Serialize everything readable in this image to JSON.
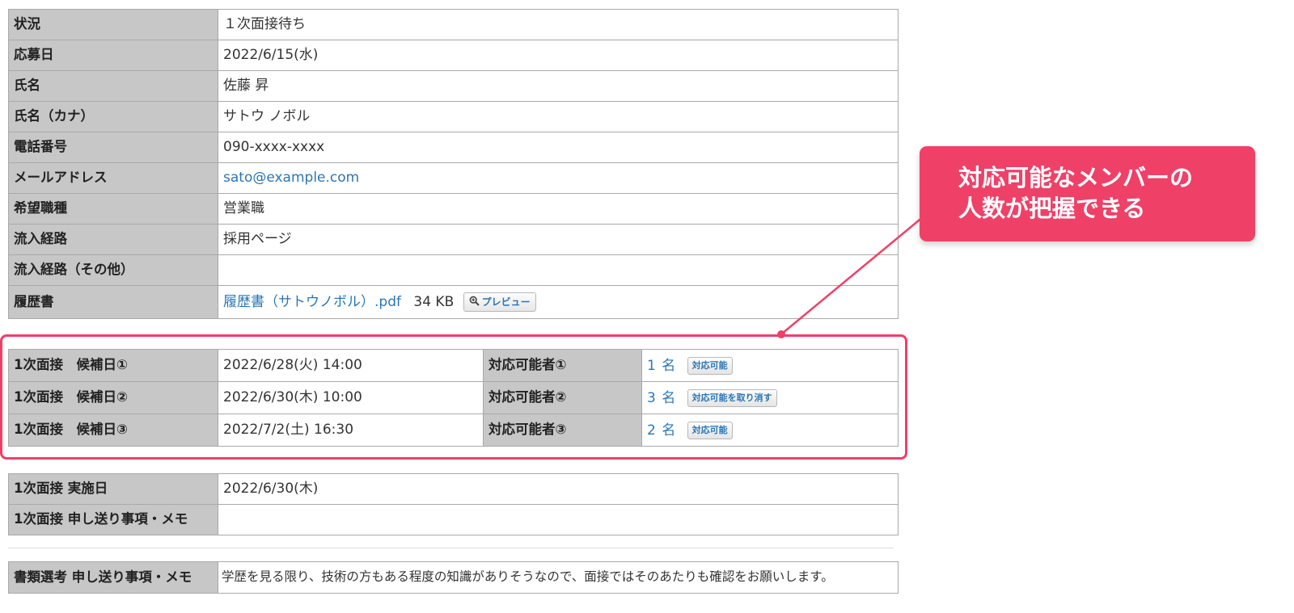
{
  "basic": {
    "rows": [
      {
        "label": "状況",
        "value": "１次面接待ち"
      },
      {
        "label": "応募日",
        "value": "2022/6/15(水)"
      },
      {
        "label": "氏名",
        "value": "佐藤 昇"
      },
      {
        "label": "氏名（カナ）",
        "value": "サトウ ノボル"
      },
      {
        "label": "電話番号",
        "value": "090-xxxx-xxxx"
      },
      {
        "label": "メールアドレス",
        "value": "sato@example.com"
      },
      {
        "label": "希望職種",
        "value": "営業職"
      },
      {
        "label": "流入経路",
        "value": "採用ページ"
      },
      {
        "label": "流入経路（その他）",
        "value": ""
      }
    ],
    "resume": {
      "label": "履歴書",
      "file_name": "履歴書（サトウノボル）.pdf",
      "file_size": "34 KB",
      "preview_label": "プレビュー"
    }
  },
  "candidates": {
    "rows": [
      {
        "label": "1次面接　候補日①",
        "datetime": "2022/6/28(火) 14:00",
        "avail_label": "対応可能者①",
        "count": "1 名",
        "button": "対応可能"
      },
      {
        "label": "1次面接　候補日②",
        "datetime": "2022/6/30(木) 10:00",
        "avail_label": "対応可能者②",
        "count": "3 名",
        "button": "対応可能を取り消す"
      },
      {
        "label": "1次面接　候補日③",
        "datetime": "2022/7/2(土) 16:30",
        "avail_label": "対応可能者③",
        "count": "2 名",
        "button": "対応可能"
      }
    ]
  },
  "execution": {
    "rows": [
      {
        "label": "1次面接 実施日",
        "value": "2022/6/30(木)"
      },
      {
        "label": "1次面接 申し送り事項・メモ",
        "value": ""
      }
    ]
  },
  "document_review": {
    "label": "書類選考 申し送り事項・メモ",
    "value": "学歴を見る限り、技術の方もある程度の知識がありそうなので、面接ではそのあたりも確認をお願いします。"
  },
  "callout": {
    "line1": "対応可能なメンバーの",
    "line2": "人数が把握できる"
  },
  "colors": {
    "accent": "#ef4168",
    "link": "#2a76b5",
    "header_bg": "#c7c7c7"
  }
}
